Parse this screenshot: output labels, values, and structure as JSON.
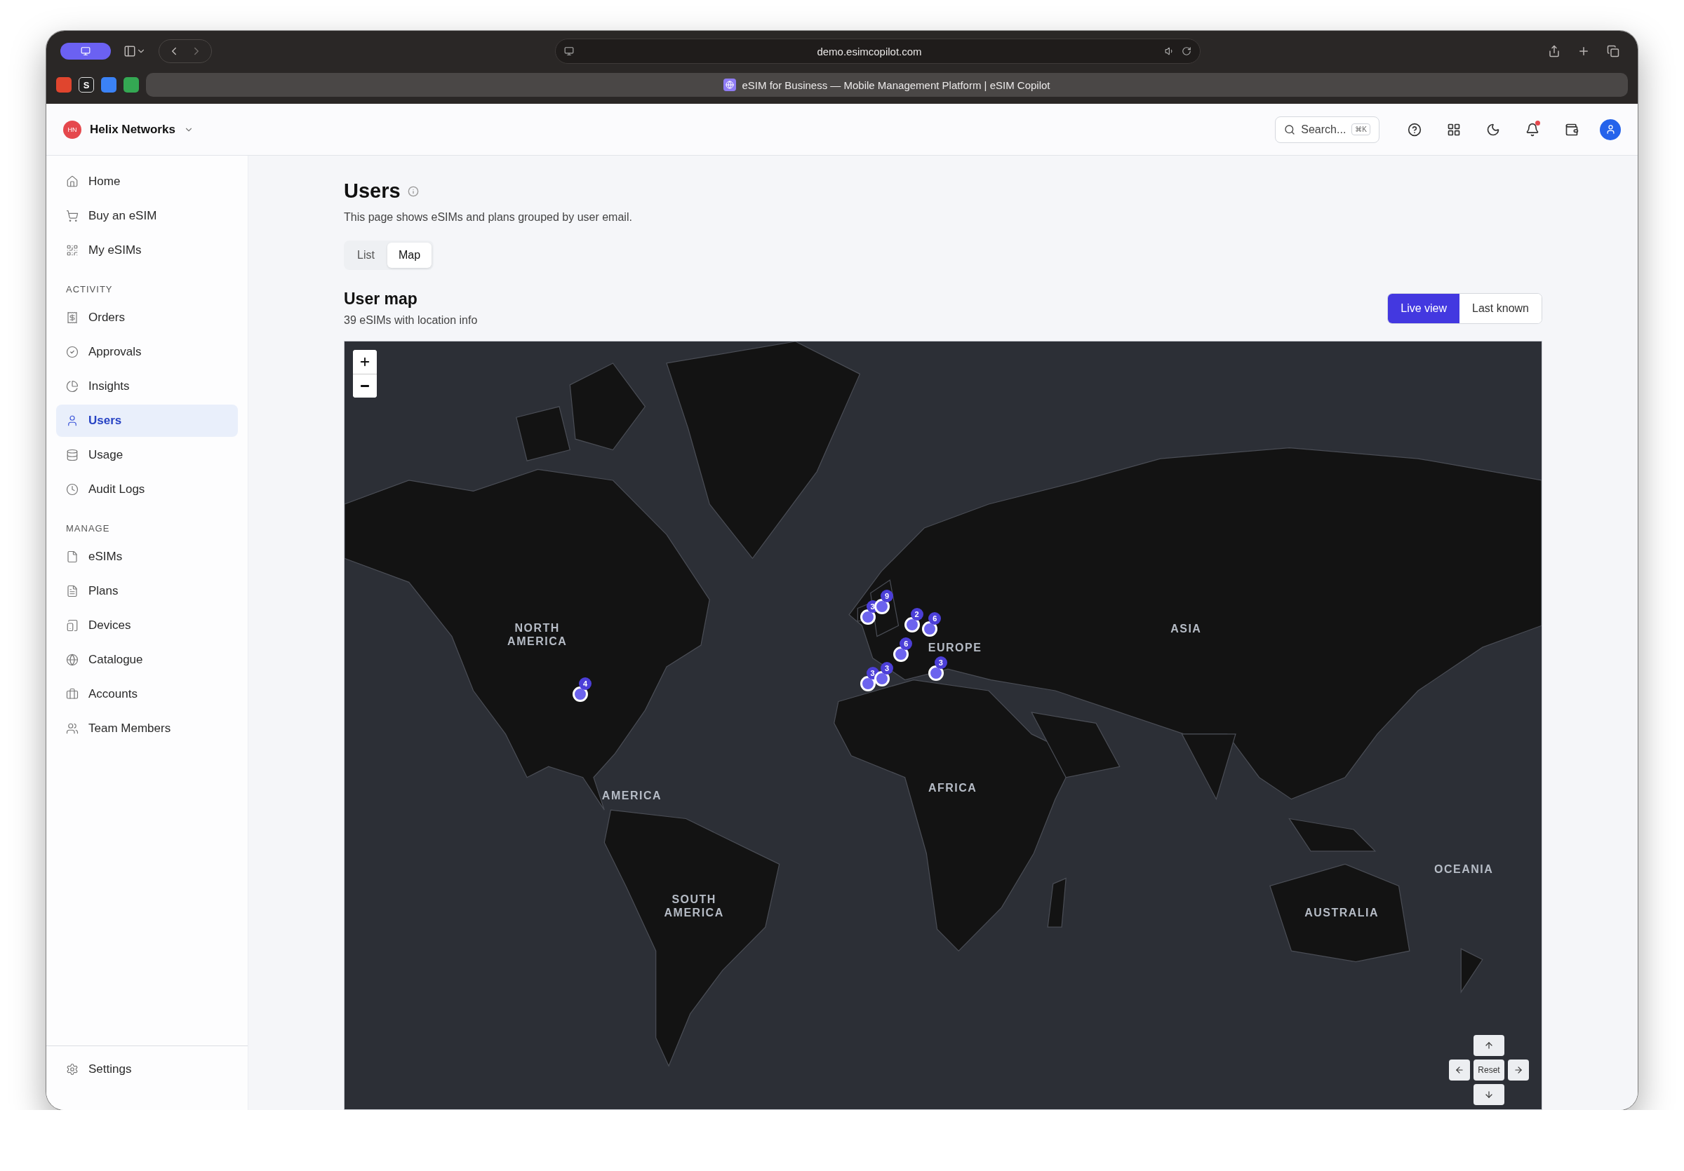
{
  "browser": {
    "url": "demo.esimcopilot.com",
    "tab_title": "eSIM for Business — Mobile Management Platform | eSIM Copilot",
    "pinned_letter": "S"
  },
  "header": {
    "org_initials": "HN",
    "org_name": "Helix Networks",
    "search": {
      "placeholder": "Search...",
      "shortcut": "⌘K"
    },
    "notifications_unread": true
  },
  "sidebar": {
    "sections": [
      {
        "items": [
          {
            "label": "Home",
            "selected": false
          },
          {
            "label": "Buy an eSIM",
            "selected": false
          },
          {
            "label": "My eSIMs",
            "selected": false
          }
        ]
      },
      {
        "heading": "ACTIVITY",
        "items": [
          {
            "label": "Orders",
            "selected": false
          },
          {
            "label": "Approvals",
            "selected": false
          },
          {
            "label": "Insights",
            "selected": false
          },
          {
            "label": "Users",
            "selected": true
          },
          {
            "label": "Usage",
            "selected": false
          },
          {
            "label": "Audit Logs",
            "selected": false
          }
        ]
      },
      {
        "heading": "MANAGE",
        "items": [
          {
            "label": "eSIMs",
            "selected": false
          },
          {
            "label": "Plans",
            "selected": false
          },
          {
            "label": "Devices",
            "selected": false
          },
          {
            "label": "Catalogue",
            "selected": false
          },
          {
            "label": "Accounts",
            "selected": false
          },
          {
            "label": "Team Members",
            "selected": false
          }
        ]
      }
    ],
    "footer": {
      "label": "Settings"
    }
  },
  "page": {
    "title": "Users",
    "description": "This page shows eSIMs and plans grouped by user email.",
    "view_tabs": [
      {
        "label": "List",
        "selected": false
      },
      {
        "label": "Map",
        "selected": true
      }
    ],
    "map_section": {
      "title": "User map",
      "subtitle": "39 eSIMs with location info",
      "mode_buttons": [
        {
          "label": "Live view",
          "selected": true
        },
        {
          "label": "Last known",
          "selected": false
        }
      ],
      "map": {
        "region_labels": [
          "NORTH AMERICA",
          "EUROPE",
          "ASIA",
          "AMERICA",
          "AFRICA",
          "SOUTH AMERICA",
          "OCEANIA",
          "AUSTRALIA"
        ],
        "markers": [
          {
            "count": "4"
          },
          {
            "count": "3"
          },
          {
            "count": "9"
          },
          {
            "count": "2"
          },
          {
            "count": "6"
          },
          {
            "count": "6"
          },
          {
            "count": "3"
          },
          {
            "count": "3"
          },
          {
            "count": "3"
          }
        ],
        "reset_label": "Reset"
      }
    }
  }
}
